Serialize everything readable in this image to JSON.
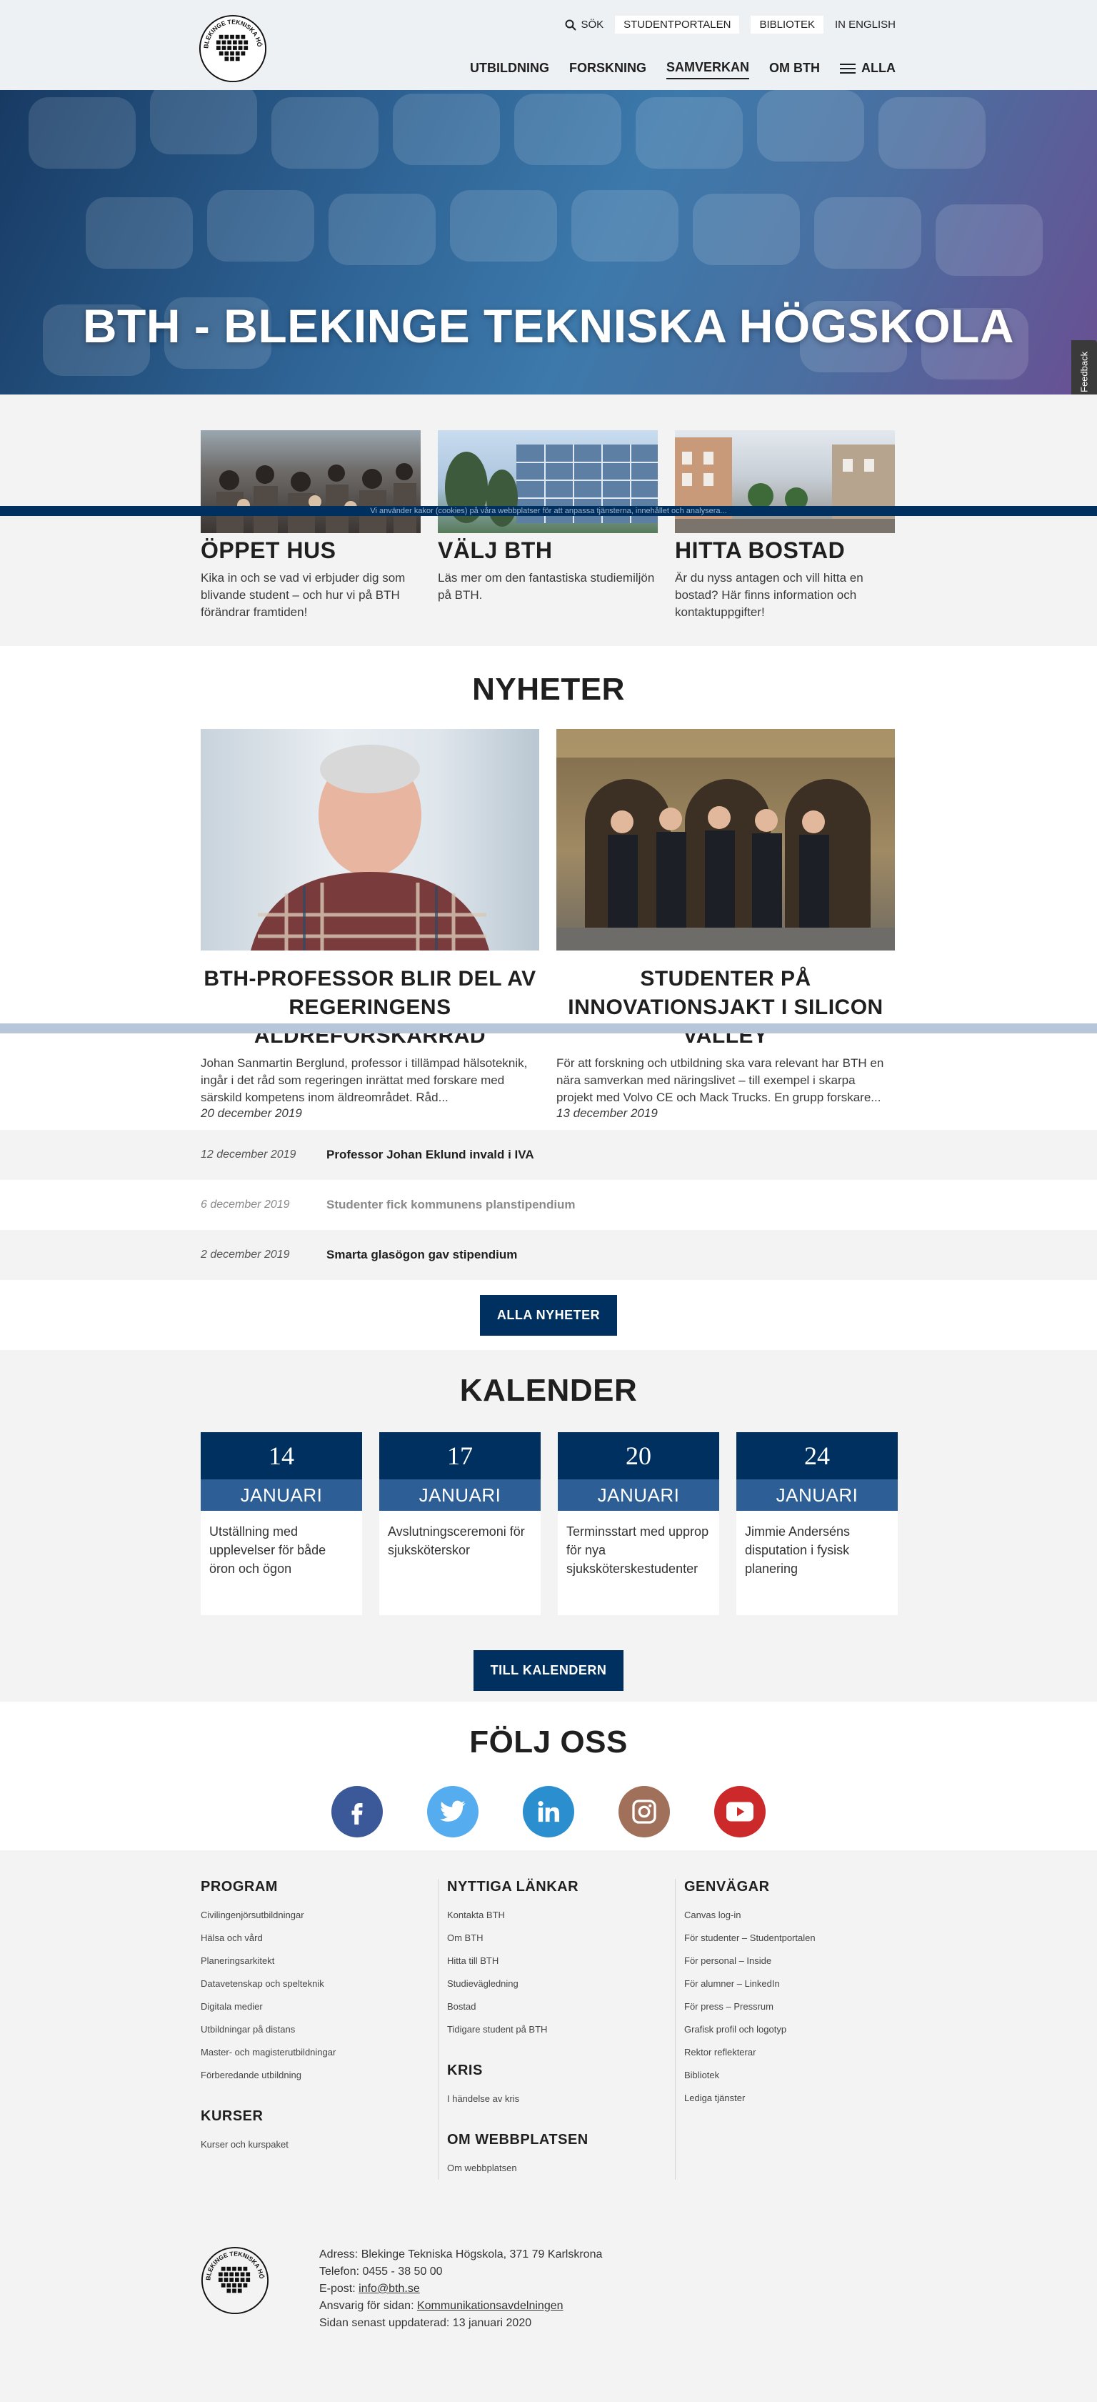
{
  "header": {
    "logo_text": "BLEKINGE TEKNISKA HÖGSKOLA · BTH ·",
    "top_links": {
      "search": "SÖK",
      "student": "STUDENTPORTALEN",
      "library": "BIBLIOTEK",
      "english": "IN ENGLISH"
    },
    "main_nav": {
      "education": "UTBILDNING",
      "research": "FORSKNING",
      "collab": "SAMVERKAN",
      "about": "OM BTH",
      "all": "ALLA"
    }
  },
  "hero": {
    "title": "BTH - BLEKINGE TEKNISKA HÖGSKOLA",
    "feedback": "Feedback"
  },
  "promo": {
    "overlay_text": "Vi använder kakor (cookies) på våra webbplatser för att anpassa tjänsterna, innehållet och analysera...",
    "cards": [
      {
        "title": "ÖPPET HUS",
        "text": "Kika in och se vad vi erbjuder dig som blivande student – och hur vi på BTH förändrar framtiden!"
      },
      {
        "title": "VÄLJ BTH",
        "text": "Läs mer om den fantastiska studiemiljön på BTH."
      },
      {
        "title": "HITTA BOSTAD",
        "text": "Är du nyss antagen och vill hitta en bostad? Här finns information och kontaktuppgifter!"
      }
    ]
  },
  "news": {
    "title": "NYHETER",
    "featured": [
      {
        "title": "BTH-PROFESSOR BLIR DEL AV REGERINGENS ÄLDREFORSKARRÅD",
        "text": "Johan Sanmartin Berglund, professor i tillämpad hälsoteknik, ingår i det råd som regeringen inrättat med forskare med särskild kompetens inom äldreområdet. Råd...",
        "date": "20 december 2019"
      },
      {
        "title": "STUDENTER PÅ INNOVATIONSJAKT I SILICON VALLEY",
        "text": "För att forskning och utbildning ska vara relevant har BTH en nära samverkan med näringslivet – till exempel i skarpa projekt med Volvo CE och Mack Trucks. En grupp forskare...",
        "date": "13 december 2019"
      }
    ],
    "list": [
      {
        "date": "12 december 2019",
        "title": "Professor Johan Eklund invald i IVA"
      },
      {
        "date": "6 december 2019",
        "title": "Studenter fick kommunens planstipendium"
      },
      {
        "date": "2 december 2019",
        "title": "Smarta glasögon gav stipendium"
      }
    ],
    "all_button": "ALLA NYHETER"
  },
  "calendar": {
    "title": "KALENDER",
    "events": [
      {
        "day": "14",
        "month": "JANUARI",
        "text": "Utställning med upplevelser för både öron och ögon"
      },
      {
        "day": "17",
        "month": "JANUARI",
        "text": "Avslutningsceremoni för sjuksköterskor"
      },
      {
        "day": "20",
        "month": "JANUARI",
        "text": "Terminsstart med upprop för nya sjuksköterskestudenter"
      },
      {
        "day": "24",
        "month": "JANUARI",
        "text": "Jimmie Anderséns disputation i fysisk planering"
      }
    ],
    "button": "TILL KALENDERN"
  },
  "follow": {
    "title": "FÖLJ OSS",
    "icons": [
      "facebook-icon",
      "twitter-icon",
      "linkedin-icon",
      "instagram-icon",
      "youtube-icon"
    ],
    "colors": {
      "facebook": "#3b5998",
      "twitter": "#55acee",
      "linkedin": "#2b8fcf",
      "instagram": "#a0705a",
      "youtube": "#cc2a2a"
    }
  },
  "footer": {
    "program": {
      "title": "PROGRAM",
      "links": [
        "Civilingenjörsutbildningar",
        "Hälsa och vård",
        "Planeringsarkitekt",
        "Datavetenskap och spelteknik",
        "Digitala medier",
        "Utbildningar på distans",
        "Master- och magisterutbildningar",
        "Förberedande utbildning"
      ]
    },
    "kurser": {
      "title": "KURSER",
      "links": [
        "Kurser och kurspaket"
      ]
    },
    "nyttiga": {
      "title": "NYTTIGA LÄNKAR",
      "links": [
        "Kontakta BTH",
        "Om BTH",
        "Hitta till BTH",
        "Studievägledning",
        "Bostad",
        "Tidigare student på BTH"
      ]
    },
    "kris": {
      "title": "KRIS",
      "links": [
        "I händelse av kris"
      ]
    },
    "webb": {
      "title": "OM WEBBPLATSEN",
      "links": [
        "Om webbplatsen"
      ]
    },
    "genvagar": {
      "title": "GENVÄGAR",
      "links": [
        "Canvas log-in",
        "För studenter – Studentportalen",
        "För personal – Inside",
        "För alumner – LinkedIn",
        "För press – Pressrum",
        "Grafisk profil och logotyp",
        "Rektor reflekterar",
        "Bibliotek",
        "Lediga tjänster"
      ]
    },
    "address": {
      "addr": "Adress: Blekinge Tekniska Högskola, 371 79 Karlskrona",
      "phone": "Telefon: 0455 - 38 50 00",
      "email_label": "E-post: ",
      "email": "info@bth.se",
      "resp_label": "Ansvarig för sidan: ",
      "resp": "Kommunikationsavdelningen",
      "updated": "Sidan senast uppdaterad: 13 januari 2020"
    }
  }
}
